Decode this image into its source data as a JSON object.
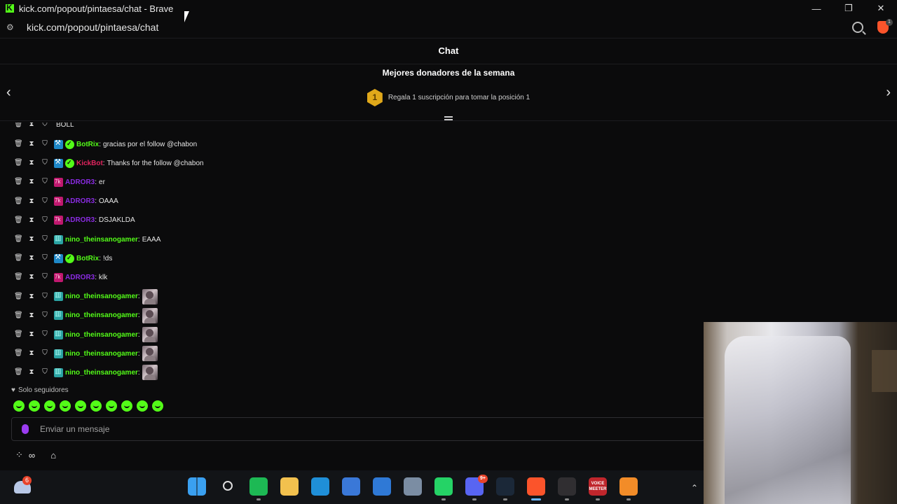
{
  "window": {
    "title": "kick.com/popout/pintaesa/chat - Brave",
    "controls": {
      "minimize": "—",
      "restore": "❐",
      "close": "✕"
    }
  },
  "address_bar": {
    "url": "kick.com/popout/pintaesa/chat",
    "brave_badge": "1"
  },
  "chat": {
    "header": "Chat",
    "donors_title": "Mejores donadores de la semana",
    "donors_rank": "1",
    "donors_text": "Regala 1 suscripción para tomar la posición 1",
    "arrow_prev": "‹",
    "arrow_next": "›",
    "partial_row": "BOLL",
    "messages": [
      {
        "user": "BotRix",
        "user_color": "#53fc18",
        "text": "gracias por el follow @chabon",
        "badges": [
          "bot",
          "verified"
        ],
        "emote": false
      },
      {
        "user": "KickBot",
        "user_color": "#e0245e",
        "text": "Thanks for the follow @chabon",
        "badges": [
          "bot",
          "verified"
        ],
        "emote": false
      },
      {
        "user": "ADROR3",
        "user_color": "#8a2be2",
        "text": "er",
        "badges": [
          "sub"
        ],
        "emote": false
      },
      {
        "user": "ADROR3",
        "user_color": "#8a2be2",
        "text": "OAAA",
        "badges": [
          "sub"
        ],
        "emote": false
      },
      {
        "user": "ADROR3",
        "user_color": "#8a2be2",
        "text": "DSJAKLDA",
        "badges": [
          "sub"
        ],
        "emote": false
      },
      {
        "user": "nino_theinsanogamer",
        "user_color": "#53fc18",
        "text": "EAAA",
        "badges": [
          "og"
        ],
        "emote": false
      },
      {
        "user": "BotRix",
        "user_color": "#53fc18",
        "text": "!ds",
        "badges": [
          "bot",
          "verified"
        ],
        "emote": false
      },
      {
        "user": "ADROR3",
        "user_color": "#8a2be2",
        "text": "klk",
        "badges": [
          "sub"
        ],
        "emote": false
      },
      {
        "user": "nino_theinsanogamer",
        "user_color": "#53fc18",
        "text": "",
        "badges": [
          "og"
        ],
        "emote": true
      },
      {
        "user": "nino_theinsanogamer",
        "user_color": "#53fc18",
        "text": "",
        "badges": [
          "og"
        ],
        "emote": true
      },
      {
        "user": "nino_theinsanogamer",
        "user_color": "#53fc18",
        "text": "",
        "badges": [
          "og"
        ],
        "emote": true
      },
      {
        "user": "nino_theinsanogamer",
        "user_color": "#53fc18",
        "text": "",
        "badges": [
          "og"
        ],
        "emote": true
      },
      {
        "user": "nino_theinsanogamer",
        "user_color": "#53fc18",
        "text": "",
        "badges": [
          "og"
        ],
        "emote": true
      }
    ],
    "followers_only": "Solo seguidores",
    "input_placeholder": "Enviar un mensaje",
    "quick_emote_count": 10
  },
  "taskbar": {
    "weather_badge": "6",
    "discord_badge": "9+",
    "voicemeeter_label": "VOICE MEETER",
    "apps": [
      {
        "name": "windows-start",
        "color": "#3aa0f0",
        "state": "none"
      },
      {
        "name": "search",
        "color": "transparent",
        "state": "none"
      },
      {
        "name": "spotify",
        "color": "#1db954",
        "state": "running"
      },
      {
        "name": "file-explorer",
        "color": "#f2c14e",
        "state": "none"
      },
      {
        "name": "edge",
        "color": "#1f8fd8",
        "state": "none"
      },
      {
        "name": "store",
        "color": "#3a78d8",
        "state": "none"
      },
      {
        "name": "outlook",
        "color": "#2f79d6",
        "state": "none"
      },
      {
        "name": "settings",
        "color": "#7b8da3",
        "state": "none"
      },
      {
        "name": "whatsapp",
        "color": "#25d366",
        "state": "running"
      },
      {
        "name": "discord",
        "color": "#5865f2",
        "state": "running"
      },
      {
        "name": "steam",
        "color": "#1b2838",
        "state": "running"
      },
      {
        "name": "brave",
        "color": "#fb542b",
        "state": "active"
      },
      {
        "name": "obs",
        "color": "#302e31",
        "state": "running"
      },
      {
        "name": "voicemeeter",
        "color": "#c0262c",
        "state": "running"
      },
      {
        "name": "fl-studio",
        "color": "#f28c28",
        "state": "running"
      }
    ]
  }
}
